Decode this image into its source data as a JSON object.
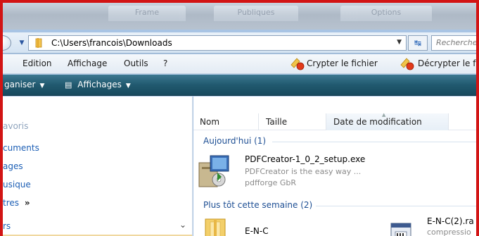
{
  "address": {
    "path": "C:\\Users\\francois\\Downloads",
    "search_placeholder": "Recherche"
  },
  "menu": {
    "items": [
      "Edition",
      "Affichage",
      "Outils",
      "?"
    ],
    "encrypt": "Crypter le fichier",
    "decrypt": "Décrypter le f"
  },
  "commands": {
    "organize": "ganiser",
    "views": "Affichages"
  },
  "sidebar": {
    "favorites": "avoris",
    "items": [
      "cuments",
      "ages",
      "usique",
      "tres"
    ],
    "more": "»",
    "folders_label": "rs"
  },
  "columns": {
    "name": "Nom",
    "size": "Taille",
    "date": "Date de modification"
  },
  "groups": {
    "today": "Aujourd'hui (1)",
    "earlier": "Plus tôt cette semaine (2)"
  },
  "files": {
    "pdfcreator": {
      "name": "PDFCreator-1_0_2_setup.exe",
      "description": "PDFCreator is the easy way ...",
      "publisher": "pdfforge GbR"
    },
    "enc_folder": {
      "name": "E-N-C"
    },
    "enc_archive": {
      "name": "E-N-C(2).ra",
      "description": "compressio"
    }
  },
  "background_tabs": [
    "Frame",
    "Publiques",
    "Options"
  ],
  "colors": {
    "frame_border": "#d21414",
    "command_bar": "#21596f",
    "link_blue": "#1d5fb5"
  }
}
